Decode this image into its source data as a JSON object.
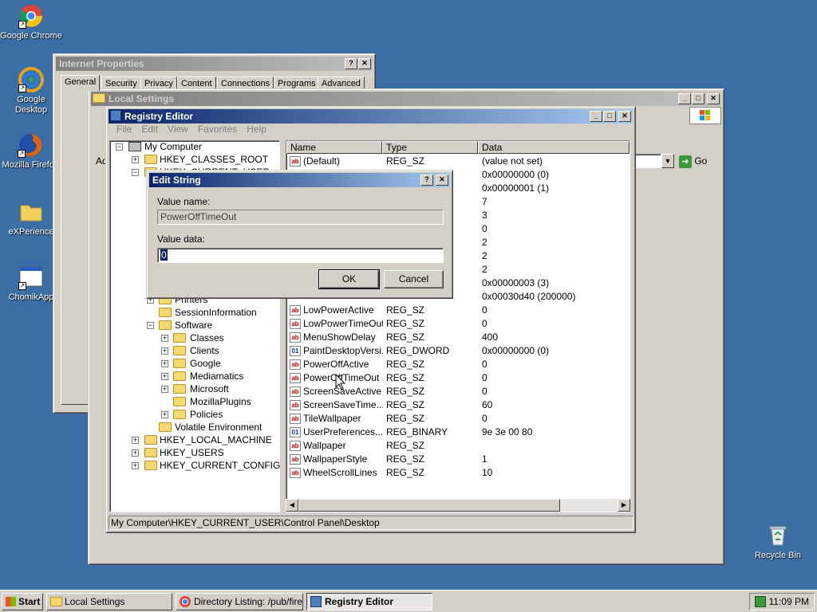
{
  "desktop": {
    "icons": [
      "Google Chrome",
      "Google Desktop",
      "Mozilla Firefox",
      "eXPerience",
      "ChomikApp",
      "Recycle Bin"
    ]
  },
  "internet_properties": {
    "title": "Internet Properties",
    "tabs": [
      "General",
      "Security",
      "Privacy",
      "Content",
      "Connections",
      "Programs",
      "Advanced"
    ]
  },
  "local_settings": {
    "title": "Local Settings",
    "address_label": "Ad",
    "go_label": "Go"
  },
  "registry": {
    "title": "Registry Editor",
    "menu": [
      "File",
      "Edit",
      "View",
      "Favorites",
      "Help"
    ],
    "tree": {
      "root": "My Computer",
      "classes_root": "HKEY_CLASSES_ROOT",
      "current_user": "HKEY_CURRENT_USER",
      "printers": "Printers",
      "session": "SessionInformation",
      "software": "Software",
      "software_children": [
        "Classes",
        "Clients",
        "Google",
        "Mediamatics",
        "Microsoft",
        "MozillaPlugins",
        "Policies"
      ],
      "volatile": "Volatile Environment",
      "hives": [
        "HKEY_LOCAL_MACHINE",
        "HKEY_USERS",
        "HKEY_CURRENT_CONFIG"
      ]
    },
    "columns": [
      "Name",
      "Type",
      "Data"
    ],
    "rows": [
      {
        "name": "(Default)",
        "type": "REG_SZ",
        "data": "(value not set)",
        "icon": "ab"
      },
      {
        "name": "",
        "type": "",
        "data": "0x00000000 (0)",
        "icon": ""
      },
      {
        "name": "",
        "type": "",
        "data": "0x00000001 (1)",
        "icon": ""
      },
      {
        "name": "",
        "type": "",
        "data": "7",
        "icon": ""
      },
      {
        "name": "",
        "type": "",
        "data": "3",
        "icon": ""
      },
      {
        "name": "",
        "type": "",
        "data": "0",
        "icon": ""
      },
      {
        "name": "",
        "type": "",
        "data": "2",
        "icon": ""
      },
      {
        "name": "",
        "type": "",
        "data": "2",
        "icon": ""
      },
      {
        "name": "",
        "type": "",
        "data": "2",
        "icon": ""
      },
      {
        "name": "",
        "type": "",
        "data": "0x00000003 (3)",
        "icon": ""
      },
      {
        "name": "",
        "type": "",
        "data": "0x00030d40 (200000)",
        "icon": ""
      },
      {
        "name": "LowPowerActive",
        "type": "REG_SZ",
        "data": "0",
        "icon": "ab"
      },
      {
        "name": "LowPowerTimeOut",
        "type": "REG_SZ",
        "data": "0",
        "icon": "ab"
      },
      {
        "name": "MenuShowDelay",
        "type": "REG_SZ",
        "data": "400",
        "icon": "ab"
      },
      {
        "name": "PaintDesktopVersi...",
        "type": "REG_DWORD",
        "data": "0x00000000 (0)",
        "icon": "bin"
      },
      {
        "name": "PowerOffActive",
        "type": "REG_SZ",
        "data": "0",
        "icon": "ab"
      },
      {
        "name": "PowerOffTimeOut",
        "type": "REG_SZ",
        "data": "0",
        "icon": "ab"
      },
      {
        "name": "ScreenSaveActive",
        "type": "REG_SZ",
        "data": "0",
        "icon": "ab"
      },
      {
        "name": "ScreenSaveTime...",
        "type": "REG_SZ",
        "data": "60",
        "icon": "ab"
      },
      {
        "name": "TileWallpaper",
        "type": "REG_SZ",
        "data": "0",
        "icon": "ab"
      },
      {
        "name": "UserPreferences...",
        "type": "REG_BINARY",
        "data": "9e 3e 00 80",
        "icon": "bin"
      },
      {
        "name": "Wallpaper",
        "type": "REG_SZ",
        "data": "",
        "icon": "ab"
      },
      {
        "name": "WallpaperStyle",
        "type": "REG_SZ",
        "data": "1",
        "icon": "ab"
      },
      {
        "name": "WheelScrollLines",
        "type": "REG_SZ",
        "data": "10",
        "icon": "ab"
      }
    ],
    "status": "My Computer\\HKEY_CURRENT_USER\\Control Panel\\Desktop"
  },
  "edit_dialog": {
    "title": "Edit String",
    "value_name_label": "Value name:",
    "value_name": "PowerOffTimeOut",
    "value_data_label": "Value data:",
    "value_data": "0",
    "ok": "OK",
    "cancel": "Cancel"
  },
  "taskbar": {
    "start": "Start",
    "tasks": [
      "Local Settings",
      "Directory Listing: /pub/fire...",
      "Registry Editor"
    ],
    "clock": "11:09 PM"
  }
}
